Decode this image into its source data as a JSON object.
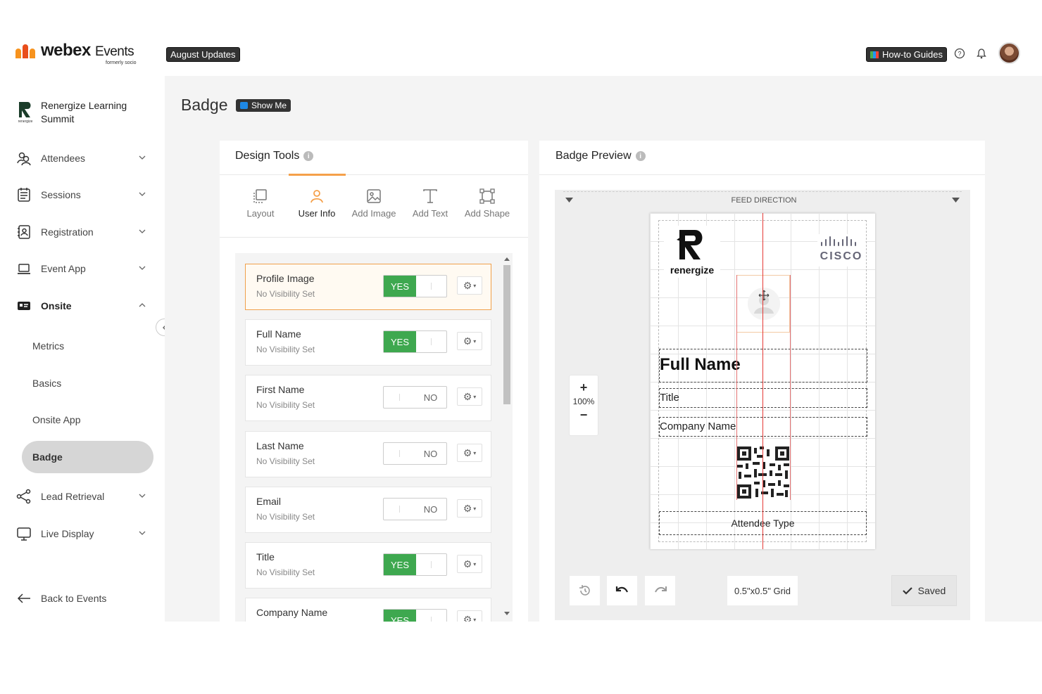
{
  "header": {
    "brand": "webex",
    "brand_suffix": "Events",
    "brand_sub": "formerly socio",
    "updates_label": "August Updates",
    "guides_label": "How-to Guides"
  },
  "sidebar": {
    "org_name": "Renergize Learning Summit",
    "org_logo_text": "renergize",
    "items": [
      {
        "label": "Attendees",
        "icon": "attendees-icon"
      },
      {
        "label": "Sessions",
        "icon": "sessions-icon"
      },
      {
        "label": "Registration",
        "icon": "registration-icon"
      },
      {
        "label": "Event App",
        "icon": "laptop-icon"
      },
      {
        "label": "Onsite",
        "icon": "onsite-icon"
      },
      {
        "label": "Lead Retrieval",
        "icon": "share-icon"
      },
      {
        "label": "Live Display",
        "icon": "monitor-icon"
      }
    ],
    "onsite_sub": [
      "Metrics",
      "Basics",
      "Onsite App",
      "Badge"
    ],
    "back_label": "Back to Events"
  },
  "page": {
    "title": "Badge",
    "show_me": "Show Me"
  },
  "design_tools": {
    "title": "Design Tools",
    "tabs": [
      "Layout",
      "User Info",
      "Add Image",
      "Add Text",
      "Add Shape"
    ],
    "active_tab": "User Info",
    "fields": [
      {
        "name": "Profile Image",
        "sub": "No Visibility Set",
        "state": "YES"
      },
      {
        "name": "Full Name",
        "sub": "No Visibility Set",
        "state": "YES"
      },
      {
        "name": "First Name",
        "sub": "No Visibility Set",
        "state": "NO"
      },
      {
        "name": "Last Name",
        "sub": "No Visibility Set",
        "state": "NO"
      },
      {
        "name": "Email",
        "sub": "No Visibility Set",
        "state": "NO"
      },
      {
        "name": "Title",
        "sub": "No Visibility Set",
        "state": "YES"
      },
      {
        "name": "Company Name",
        "sub": "",
        "state": "YES"
      }
    ]
  },
  "preview": {
    "title": "Badge Preview",
    "feed_direction": "FEED DIRECTION",
    "logo_text": "renergize",
    "sponsor_text": "CISCO",
    "full_name": "Full Name",
    "title_field": "Title",
    "company_field": "Company Name",
    "attendee_type": "Attendee Type",
    "zoom": "100%",
    "zoom_in": "+",
    "zoom_out": "−",
    "grid_label": "0.5\"x0.5\" Grid",
    "saved_label": "Saved"
  },
  "colors": {
    "accent": "#f5a04a",
    "toggle_on": "#3ea84f",
    "guide_line": "#e57373"
  }
}
